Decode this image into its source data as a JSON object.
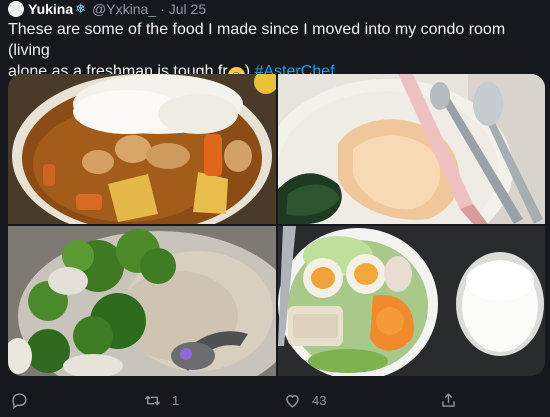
{
  "tweet": {
    "author_name": "Yukina",
    "author_badge": "❄",
    "handle": "@Yxkina_",
    "separator": "·",
    "date": "Jul 25",
    "text_line1": "These are some of the food I made since I moved into my condo room (living",
    "text_line2_before": "alone as a freshman is tough fr",
    "text_line2_after": ")",
    "hashtag": "#AsterChef"
  },
  "images": [
    {
      "label": "curry-rice-photo"
    },
    {
      "label": "chicken-spinach-photo"
    },
    {
      "label": "broccoli-oatmeal-photo"
    },
    {
      "label": "egg-salad-milk-photo"
    }
  ],
  "actions": {
    "retweet_count": "1",
    "like_count": "43"
  },
  "colors": {
    "background": "#15181c",
    "hashtag": "#1d9bf0",
    "muted": "#8b98a5"
  }
}
